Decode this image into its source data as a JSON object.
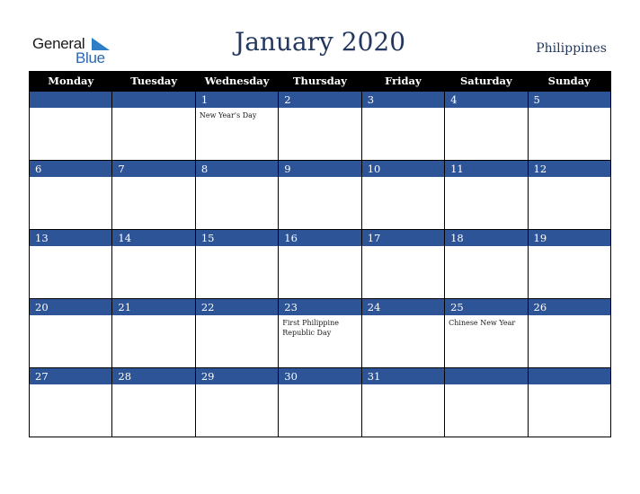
{
  "logo": {
    "line1": "General",
    "line2": "Blue"
  },
  "title": "January 2020",
  "country": "Philippines",
  "colors": {
    "header_bg": "#000000",
    "date_strip": "#2d5496",
    "title": "#23385f",
    "logo_blue": "#2c67b0"
  },
  "weekdays": [
    "Monday",
    "Tuesday",
    "Wednesday",
    "Thursday",
    "Friday",
    "Saturday",
    "Sunday"
  ],
  "weeks": [
    [
      {
        "day": "",
        "event": ""
      },
      {
        "day": "",
        "event": ""
      },
      {
        "day": "1",
        "event": "New Year's Day"
      },
      {
        "day": "2",
        "event": ""
      },
      {
        "day": "3",
        "event": ""
      },
      {
        "day": "4",
        "event": ""
      },
      {
        "day": "5",
        "event": ""
      }
    ],
    [
      {
        "day": "6",
        "event": ""
      },
      {
        "day": "7",
        "event": ""
      },
      {
        "day": "8",
        "event": ""
      },
      {
        "day": "9",
        "event": ""
      },
      {
        "day": "10",
        "event": ""
      },
      {
        "day": "11",
        "event": ""
      },
      {
        "day": "12",
        "event": ""
      }
    ],
    [
      {
        "day": "13",
        "event": ""
      },
      {
        "day": "14",
        "event": ""
      },
      {
        "day": "15",
        "event": ""
      },
      {
        "day": "16",
        "event": ""
      },
      {
        "day": "17",
        "event": ""
      },
      {
        "day": "18",
        "event": ""
      },
      {
        "day": "19",
        "event": ""
      }
    ],
    [
      {
        "day": "20",
        "event": ""
      },
      {
        "day": "21",
        "event": ""
      },
      {
        "day": "22",
        "event": ""
      },
      {
        "day": "23",
        "event": "First Philippine Republic Day"
      },
      {
        "day": "24",
        "event": ""
      },
      {
        "day": "25",
        "event": "Chinese New Year"
      },
      {
        "day": "26",
        "event": ""
      }
    ],
    [
      {
        "day": "27",
        "event": ""
      },
      {
        "day": "28",
        "event": ""
      },
      {
        "day": "29",
        "event": ""
      },
      {
        "day": "30",
        "event": ""
      },
      {
        "day": "31",
        "event": ""
      },
      {
        "day": "",
        "event": ""
      },
      {
        "day": "",
        "event": ""
      }
    ]
  ]
}
